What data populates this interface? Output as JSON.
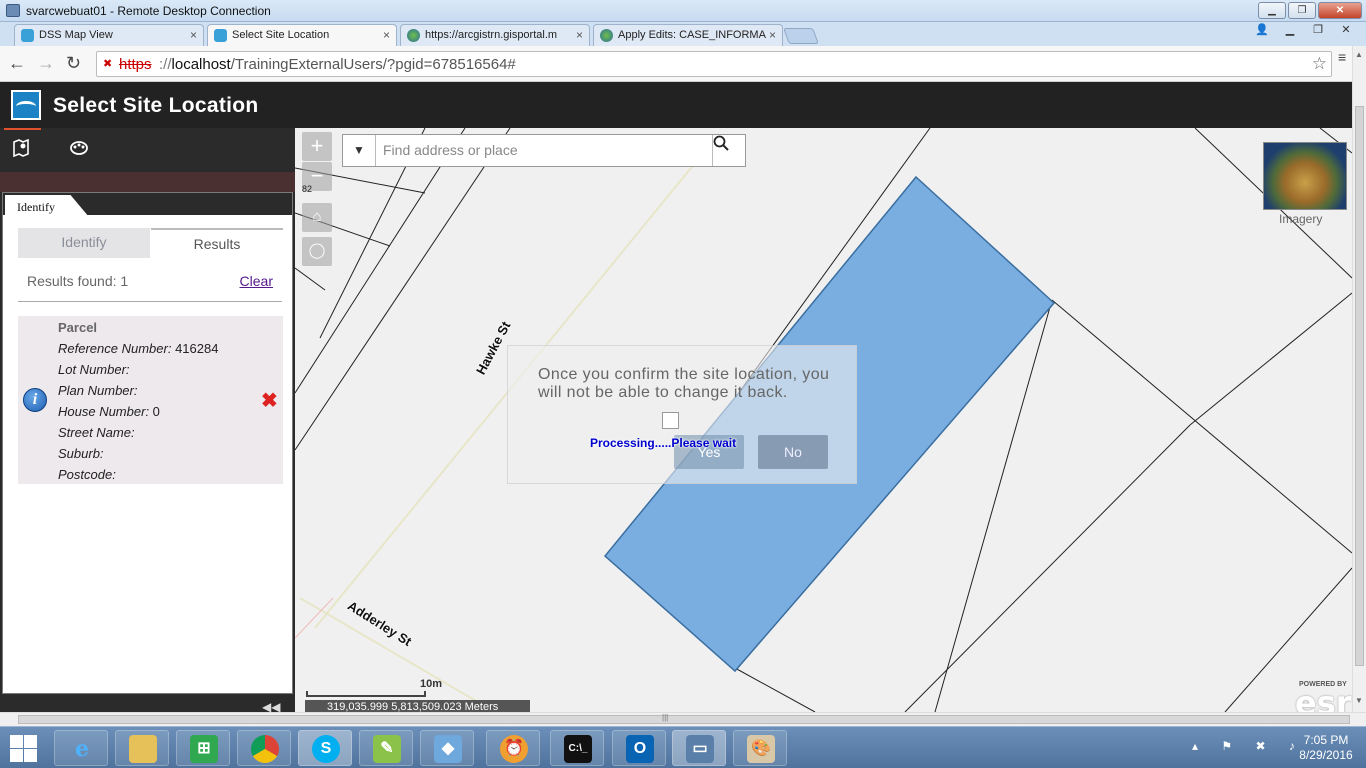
{
  "rdp": {
    "title": "svarcwebuat01 - Remote Desktop Connection"
  },
  "tabs": [
    {
      "label": "DSS Map View",
      "active": false
    },
    {
      "label": "Select Site Location",
      "active": true
    },
    {
      "label": "https://arcgistrn.gisportal.m",
      "active": false
    },
    {
      "label": "Apply Edits: CASE_INFORMA",
      "active": false
    }
  ],
  "address_bar": {
    "protocol": "https",
    "host": "localhost",
    "path": "/TrainingExternalUsers/?pgid=678516564#"
  },
  "app": {
    "title": "Select Site Location"
  },
  "panel": {
    "tab_label": "Identify",
    "subtabs": {
      "identify": "Identify",
      "results": "Results"
    },
    "results_found_label": "Results found:",
    "results_found_count": "1",
    "clear_label": "Clear",
    "result": {
      "title": "Parcel",
      "fields": [
        {
          "label": "Reference Number",
          "value": "416284"
        },
        {
          "label": "Lot Number",
          "value": ""
        },
        {
          "label": "Plan Number",
          "value": ""
        },
        {
          "label": "House Number",
          "value": "0"
        },
        {
          "label": "Street Name",
          "value": ""
        },
        {
          "label": "Suburb",
          "value": ""
        },
        {
          "label": "Postcode",
          "value": ""
        }
      ]
    }
  },
  "map": {
    "search_placeholder": "Find address or place",
    "zoom_level_label": "82",
    "basemap_label": "Imagery",
    "roads": {
      "road1": "Hawke St",
      "road2": "Adderley St"
    },
    "scale_label": "10m",
    "coordinates": "319,035.999 5,813,509.023 Meters",
    "powered_by": "POWERED BY",
    "brand": "esri",
    "parcel_fill": "#7aaee0"
  },
  "dialog": {
    "message": "Once you confirm the site location, you will not be able to change it back.",
    "yes_label": "Yes",
    "no_label": "No",
    "processing": "Processing.....Please wait"
  },
  "taskbar": {
    "time": "7:05 PM",
    "date": "8/29/2016"
  }
}
